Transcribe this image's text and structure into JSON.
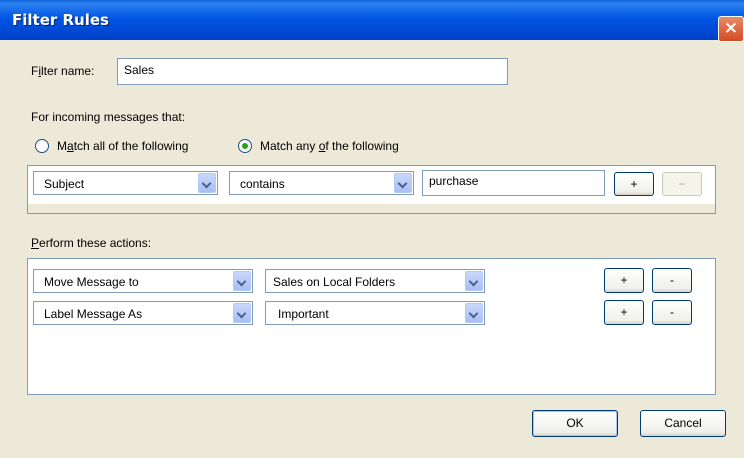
{
  "window": {
    "title": "Filter Rules",
    "close_icon": "×"
  },
  "filter_name": {
    "label": "Filter name:",
    "value": "Sales"
  },
  "match": {
    "heading": "For incoming messages that:",
    "option_all": "Match all of the following",
    "option_any": "Match any of the following",
    "selected": "any"
  },
  "condition": {
    "field": "Subject",
    "operator": "contains",
    "value": "purchase",
    "add_label": "+",
    "remove_label": "−"
  },
  "actions": {
    "heading": "Perform these actions:",
    "rows": [
      {
        "action": "Move Message to",
        "target": "Sales on Local Folders",
        "add_label": "+",
        "remove_label": "-"
      },
      {
        "action": "Label Message As",
        "target": "Important",
        "add_label": "+",
        "remove_label": "-"
      }
    ]
  },
  "buttons": {
    "ok": "OK",
    "cancel": "Cancel"
  }
}
